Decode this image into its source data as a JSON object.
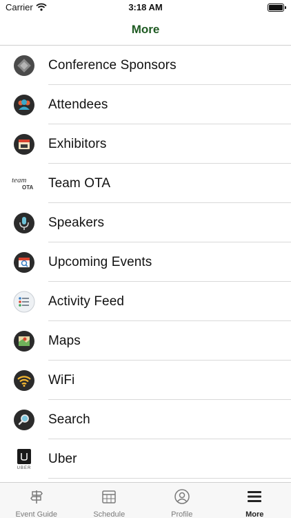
{
  "status_bar": {
    "carrier": "Carrier",
    "time": "3:18 AM"
  },
  "nav": {
    "title": "More"
  },
  "menu": [
    {
      "label": "Conference Sponsors",
      "icon": "sponsors-icon"
    },
    {
      "label": "Attendees",
      "icon": "attendees-icon"
    },
    {
      "label": "Exhibitors",
      "icon": "exhibitors-icon"
    },
    {
      "label": "Team OTA",
      "icon": "team-ota-logo-icon",
      "logo_text": [
        "team",
        "OTA"
      ]
    },
    {
      "label": "Speakers",
      "icon": "microphone-icon"
    },
    {
      "label": "Upcoming Events",
      "icon": "calendar-search-icon"
    },
    {
      "label": "Activity Feed",
      "icon": "activity-feed-icon"
    },
    {
      "label": "Maps",
      "icon": "map-icon"
    },
    {
      "label": "WiFi",
      "icon": "wifi-icon"
    },
    {
      "label": "Search",
      "icon": "search-icon"
    },
    {
      "label": "Uber",
      "icon": "uber-icon",
      "logo_text": "UBER"
    }
  ],
  "tabs": [
    {
      "label": "Event Guide",
      "icon": "signpost-icon",
      "active": false
    },
    {
      "label": "Schedule",
      "icon": "calendar-icon",
      "active": false
    },
    {
      "label": "Profile",
      "icon": "profile-icon",
      "active": false
    },
    {
      "label": "More",
      "icon": "hamburger-menu-icon",
      "active": true
    }
  ],
  "colors": {
    "title_green": "#1e5a22",
    "tab_inactive": "#7a7a7a",
    "tab_active": "#222222",
    "separator": "#d9d9d9"
  }
}
